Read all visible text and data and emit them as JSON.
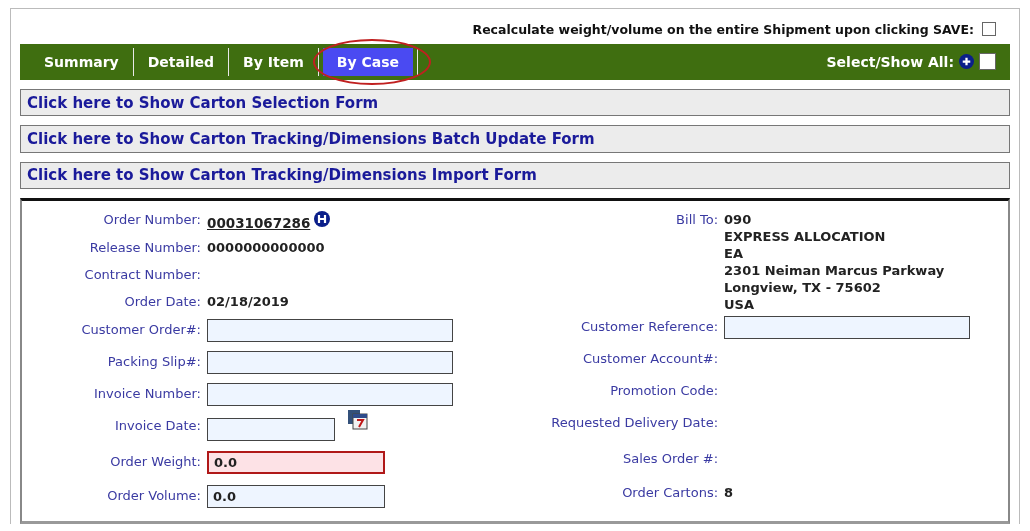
{
  "recalculate": {
    "label": "Recalculate weight/volume on the entire Shipment upon clicking SAVE:",
    "checked": false
  },
  "tabs": [
    {
      "label": "Summary",
      "selected": false
    },
    {
      "label": "Detailed",
      "selected": false
    },
    {
      "label": "By Item",
      "selected": false
    },
    {
      "label": "By Case",
      "selected": true
    }
  ],
  "select_all": {
    "label": "Select/Show All:",
    "checked": false
  },
  "form_links": [
    "Click here to Show Carton Selection Form",
    "Click here to Show Carton Tracking/Dimensions Batch Update Form",
    "Click here to Show Carton Tracking/Dimensions Import Form"
  ],
  "left_fields": [
    {
      "kind": "link",
      "label": "Order Number:",
      "value": "00031067286"
    },
    {
      "kind": "text",
      "label": "Release Number:",
      "value": "0000000000000"
    },
    {
      "kind": "text",
      "label": "Contract Number:"
    },
    {
      "kind": "text",
      "label": "Order Date:",
      "value": "02/18/2019"
    },
    {
      "kind": "input",
      "label": "Customer Order#:",
      "invalid": false
    },
    {
      "kind": "input",
      "label": "Packing Slip#:",
      "invalid": false
    },
    {
      "kind": "input",
      "label": "Invoice Number:",
      "invalid": false
    },
    {
      "kind": "date",
      "label": "Invoice Date:",
      "invalid": false
    },
    {
      "kind": "short",
      "label": "Order Weight:",
      "value": "0.0",
      "invalid": true
    },
    {
      "kind": "short",
      "label": "Order Volume:",
      "value": "0.0",
      "invalid": false
    }
  ],
  "bill_to": {
    "label": "Bill To:",
    "lines": [
      "090",
      "EXPRESS ALLOCATION",
      "EA",
      "2301 Neiman Marcus Parkway",
      "Longview, TX - 75602",
      "USA"
    ]
  },
  "right_fields": [
    {
      "kind": "input",
      "label": "Customer Reference:",
      "invalid": false
    },
    {
      "kind": "text",
      "label": "Customer Account#:"
    },
    {
      "kind": "text",
      "label": "Promotion Code:"
    },
    {
      "kind": "text",
      "label": "Requested Delivery Date:"
    },
    {
      "kind": "text",
      "label": "Sales Order #:"
    },
    {
      "kind": "text",
      "label": "Order Cartons:",
      "value": "8"
    }
  ]
}
